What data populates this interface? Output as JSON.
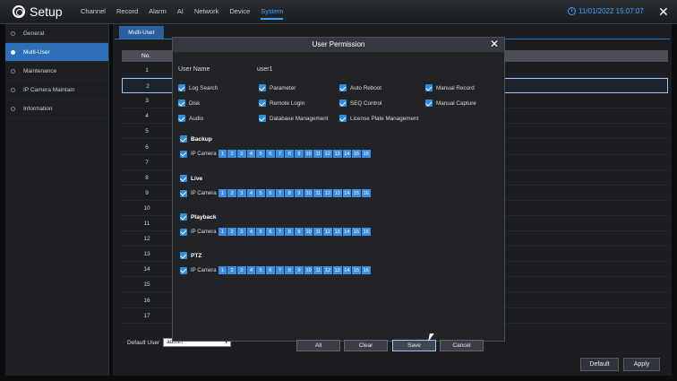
{
  "app": {
    "title": "Setup",
    "datetime": "11/01/2022 15:07:07"
  },
  "nav": {
    "items": [
      "Channel",
      "Record",
      "Alarm",
      "AI",
      "Network",
      "Device",
      "System"
    ],
    "active": "System"
  },
  "sidebar": {
    "items": [
      {
        "label": "General"
      },
      {
        "label": "Multi-User",
        "active": true
      },
      {
        "label": "Maintenance"
      },
      {
        "label": "IP Camera Maintain"
      },
      {
        "label": "Information"
      }
    ]
  },
  "main": {
    "tab": "Multi-User",
    "table": {
      "col_no": "No.",
      "rows": [
        "1",
        "2",
        "3",
        "4",
        "5",
        "6",
        "7",
        "8",
        "9",
        "10",
        "11",
        "12",
        "13",
        "14",
        "15",
        "16",
        "17"
      ],
      "selected_row": "2"
    },
    "default_user": {
      "label": "Default User",
      "value": "admin"
    },
    "buttons": {
      "default": "Default",
      "apply": "Apply"
    }
  },
  "dialog": {
    "title": "User Permission",
    "user_name_label": "User Name",
    "user_name_value": "user1",
    "permissions": [
      "Log Search",
      "Parameter",
      "Auto Reboot",
      "Manual Record",
      "Disk",
      "Remote Login",
      "SEQ Control",
      "Manual Capture",
      "Audio",
      "Database Management",
      "License Plate Management"
    ],
    "sections": [
      {
        "title": "Backup",
        "camera_label": "IP Camera"
      },
      {
        "title": "Live",
        "camera_label": "IP Camera"
      },
      {
        "title": "Playback",
        "camera_label": "IP Camera"
      },
      {
        "title": "PTZ",
        "camera_label": "IP Camera"
      }
    ],
    "channels": [
      "1",
      "2",
      "3",
      "4",
      "5",
      "6",
      "7",
      "8",
      "9",
      "10",
      "11",
      "12",
      "13",
      "14",
      "15",
      "16"
    ],
    "buttons": {
      "all": "All",
      "clear": "Clear",
      "save": "Save",
      "cancel": "Cancel"
    }
  },
  "colors": {
    "accent": "#3ea3ff",
    "checkbox": "#2f8ddf",
    "channel": "#3c8ee0",
    "active_side": "#2d6fb8"
  }
}
